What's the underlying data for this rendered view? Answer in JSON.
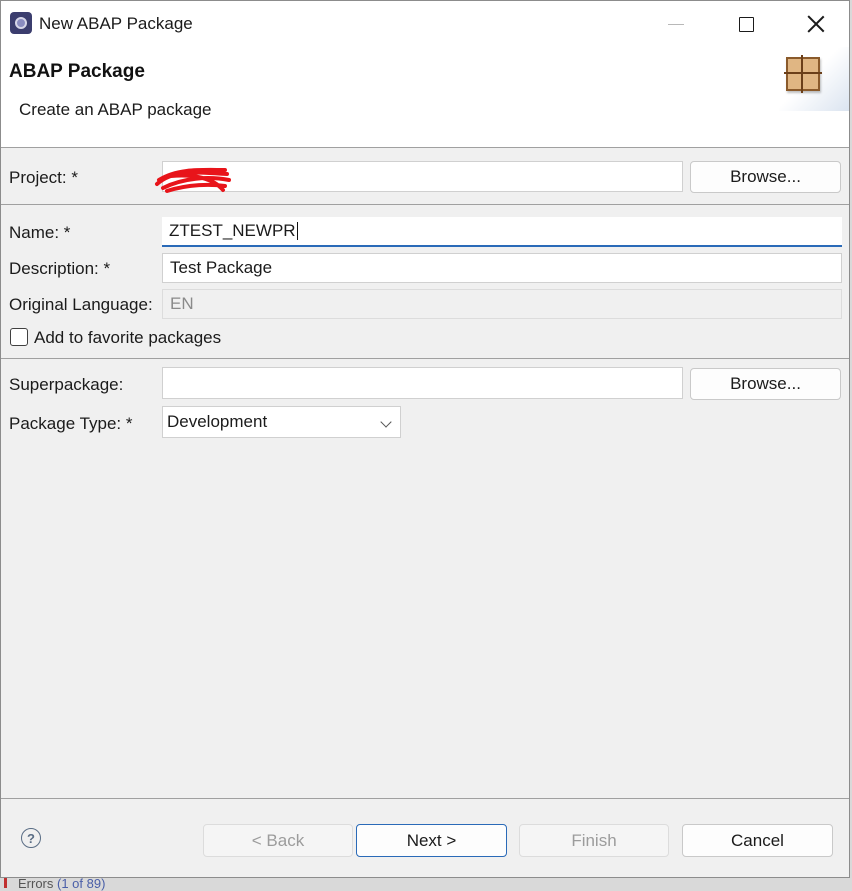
{
  "window": {
    "title": "New ABAP Package"
  },
  "banner": {
    "title": "ABAP Package",
    "description": "Create an ABAP package",
    "icon": "package-icon"
  },
  "form": {
    "project": {
      "label": "Project: *",
      "value": "",
      "browse_label": "Browse..."
    },
    "name": {
      "label": "Name: *",
      "value": "ZTEST_NEWPR"
    },
    "description": {
      "label": "Description: *",
      "value": "Test Package"
    },
    "original_language": {
      "label": "Original Language:",
      "value": "EN"
    },
    "favorite": {
      "label": "Add to favorite packages",
      "checked": false
    },
    "superpackage": {
      "label": "Superpackage:",
      "value": "",
      "browse_label": "Browse..."
    },
    "package_type": {
      "label": "Package Type: *",
      "value": "Development"
    }
  },
  "footer": {
    "help_glyph": "?",
    "back_label": "< Back",
    "next_label": "Next >",
    "finish_label": "Finish",
    "cancel_label": "Cancel"
  },
  "underlay": {
    "text": "Errors",
    "link": "(1 of 89)"
  },
  "colors": {
    "focus_accent": "#2a6ab8",
    "redaction": "#e8141a"
  }
}
